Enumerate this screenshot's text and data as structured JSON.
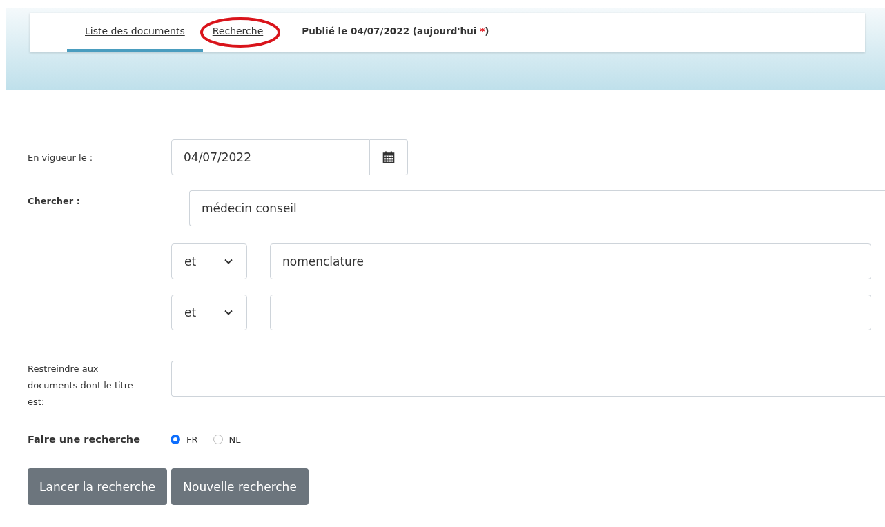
{
  "tabs": [
    {
      "label": "Liste des documents",
      "selected": true,
      "circled": false
    },
    {
      "label": "Recherche",
      "selected": false,
      "circled": true
    }
  ],
  "published": {
    "text": "Publié le 04/07/2022 (aujourd'hui ",
    "required_mark": "*",
    "closing": ")"
  },
  "form": {
    "date": {
      "label": "En vigueur le :",
      "value": "04/07/2022"
    },
    "search": {
      "label": "Chercher :",
      "value": "médecin conseil"
    },
    "terms": [
      {
        "operator": "et",
        "value": "nomenclature"
      },
      {
        "operator": "et"
      }
    ],
    "title_filter": {
      "label": "Restreindre aux documents dont le titre est:"
    },
    "language": {
      "label": "Faire une recherche",
      "options": [
        {
          "label": "FR",
          "selected": true
        },
        {
          "label": "NL",
          "selected": false
        }
      ]
    },
    "buttons": [
      "Lancer la recherche",
      "Nouvelle recherche"
    ]
  }
}
